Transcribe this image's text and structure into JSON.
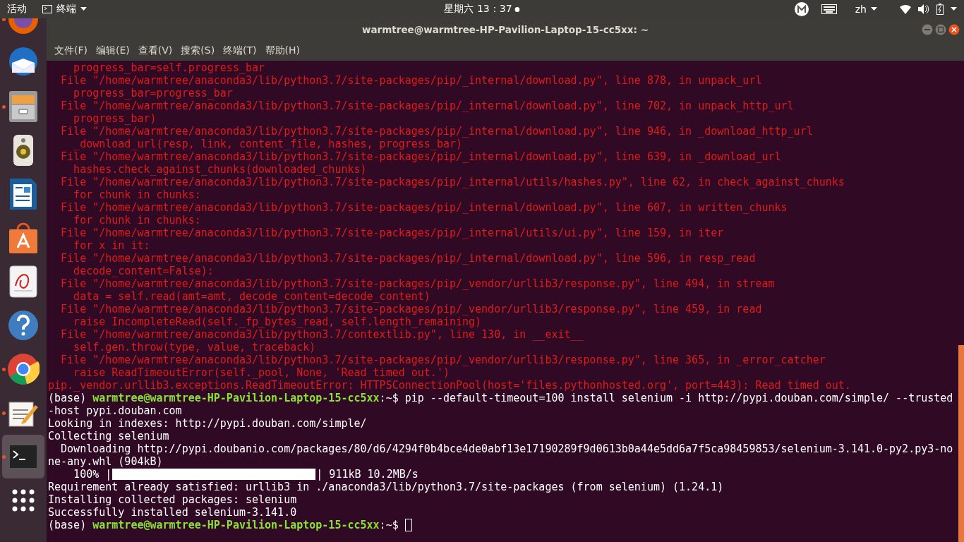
{
  "top_bar": {
    "activities": "活动",
    "app_menu": "终端",
    "clock": "星期六 13：37",
    "language": "zh"
  },
  "dock": [
    {
      "running": true,
      "selected": false
    },
    {
      "running": false,
      "selected": false
    },
    {
      "running": true,
      "selected": false
    },
    {
      "running": false,
      "selected": false
    },
    {
      "running": false,
      "selected": false
    },
    {
      "running": false,
      "selected": false
    },
    {
      "running": false,
      "selected": false
    },
    {
      "running": false,
      "selected": false
    },
    {
      "running": true,
      "selected": false
    },
    {
      "running": true,
      "selected": false
    },
    {
      "running": true,
      "selected": true
    },
    {
      "running": false,
      "selected": false
    }
  ],
  "window": {
    "title": "warmtree@warmtree-HP-Pavilion-Laptop-15-cc5xx: ~"
  },
  "menu": [
    "文件(F)",
    "编辑(E)",
    "查看(V)",
    "搜索(S)",
    "终端(T)",
    "帮助(H)"
  ],
  "lines": [
    {
      "kind": "error",
      "text": "    progress_bar=self.progress_bar"
    },
    {
      "kind": "error",
      "text": "  File \"/home/warmtree/anaconda3/lib/python3.7/site-packages/pip/_internal/download.py\", line 878, in unpack_url"
    },
    {
      "kind": "error",
      "text": "    progress_bar=progress_bar"
    },
    {
      "kind": "error",
      "text": "  File \"/home/warmtree/anaconda3/lib/python3.7/site-packages/pip/_internal/download.py\", line 702, in unpack_http_url"
    },
    {
      "kind": "error",
      "text": "    progress_bar)"
    },
    {
      "kind": "error",
      "text": "  File \"/home/warmtree/anaconda3/lib/python3.7/site-packages/pip/_internal/download.py\", line 946, in _download_http_url"
    },
    {
      "kind": "error",
      "text": "    _download_url(resp, link, content_file, hashes, progress_bar)"
    },
    {
      "kind": "error",
      "text": "  File \"/home/warmtree/anaconda3/lib/python3.7/site-packages/pip/_internal/download.py\", line 639, in _download_url"
    },
    {
      "kind": "error",
      "text": "    hashes.check_against_chunks(downloaded_chunks)"
    },
    {
      "kind": "error",
      "text": "  File \"/home/warmtree/anaconda3/lib/python3.7/site-packages/pip/_internal/utils/hashes.py\", line 62, in check_against_chunks"
    },
    {
      "kind": "error",
      "text": "    for chunk in chunks:"
    },
    {
      "kind": "error",
      "text": "  File \"/home/warmtree/anaconda3/lib/python3.7/site-packages/pip/_internal/download.py\", line 607, in written_chunks"
    },
    {
      "kind": "error",
      "text": "    for chunk in chunks:"
    },
    {
      "kind": "error",
      "text": "  File \"/home/warmtree/anaconda3/lib/python3.7/site-packages/pip/_internal/utils/ui.py\", line 159, in iter"
    },
    {
      "kind": "error",
      "text": "    for x in it:"
    },
    {
      "kind": "error",
      "text": "  File \"/home/warmtree/anaconda3/lib/python3.7/site-packages/pip/_internal/download.py\", line 596, in resp_read"
    },
    {
      "kind": "error",
      "text": "    decode_content=False):"
    },
    {
      "kind": "error",
      "text": "  File \"/home/warmtree/anaconda3/lib/python3.7/site-packages/pip/_vendor/urllib3/response.py\", line 494, in stream"
    },
    {
      "kind": "error",
      "text": "    data = self.read(amt=amt, decode_content=decode_content)"
    },
    {
      "kind": "error",
      "text": "  File \"/home/warmtree/anaconda3/lib/python3.7/site-packages/pip/_vendor/urllib3/response.py\", line 459, in read"
    },
    {
      "kind": "error",
      "text": "    raise IncompleteRead(self._fp_bytes_read, self.length_remaining)"
    },
    {
      "kind": "error",
      "text": "  File \"/home/warmtree/anaconda3/lib/python3.7/contextlib.py\", line 130, in __exit__"
    },
    {
      "kind": "error",
      "text": "    self.gen.throw(type, value, traceback)"
    },
    {
      "kind": "error",
      "text": "  File \"/home/warmtree/anaconda3/lib/python3.7/site-packages/pip/_vendor/urllib3/response.py\", line 365, in _error_catcher"
    },
    {
      "kind": "error",
      "text": "    raise ReadTimeoutError(self._pool, None, 'Read timed out.')"
    },
    {
      "kind": "error",
      "text": "pip._vendor.urllib3.exceptions.ReadTimeoutError: HTTPSConnectionPool(host='files.pythonhosted.org', port=443): Read timed out."
    },
    {
      "kind": "prompt",
      "env": "(base) ",
      "user": "warmtree@warmtree-HP-Pavilion-Laptop-15-cc5xx",
      "path": ":~$ ",
      "command": "pip --default-timeout=100 install selenium -i http://pypi.douban.com/simple/ --trusted",
      "cursor": false
    },
    {
      "kind": "output",
      "text": "-host pypi.douban.com"
    },
    {
      "kind": "output",
      "text": "Looking in indexes: http://pypi.douban.com/simple/"
    },
    {
      "kind": "output",
      "text": "Collecting selenium"
    },
    {
      "kind": "output",
      "text": "  Downloading http://pypi.doubanio.com/packages/80/d6/4294f0b4bce4de0abf13e17190289f9d0613b0a44e5dd6a7f5ca98459853/selenium-3.141.0-py2.py3-no"
    },
    {
      "kind": "output",
      "text": "ne-any.whl (904kB)"
    },
    {
      "kind": "progress",
      "prefix": "    100% |",
      "level": 1,
      "suffix": "| 911kB 10.2MB/s"
    },
    {
      "kind": "output",
      "text": "Requirement already satisfied: urllib3 in ./anaconda3/lib/python3.7/site-packages (from selenium) (1.24.1)"
    },
    {
      "kind": "output",
      "text": "Installing collected packages: selenium"
    },
    {
      "kind": "output",
      "text": "Successfully installed selenium-3.141.0"
    },
    {
      "kind": "prompt",
      "env": "(base) ",
      "user": "warmtree@warmtree-HP-Pavilion-Laptop-15-cc5xx",
      "path": ":~$ ",
      "cursor": true
    }
  ]
}
